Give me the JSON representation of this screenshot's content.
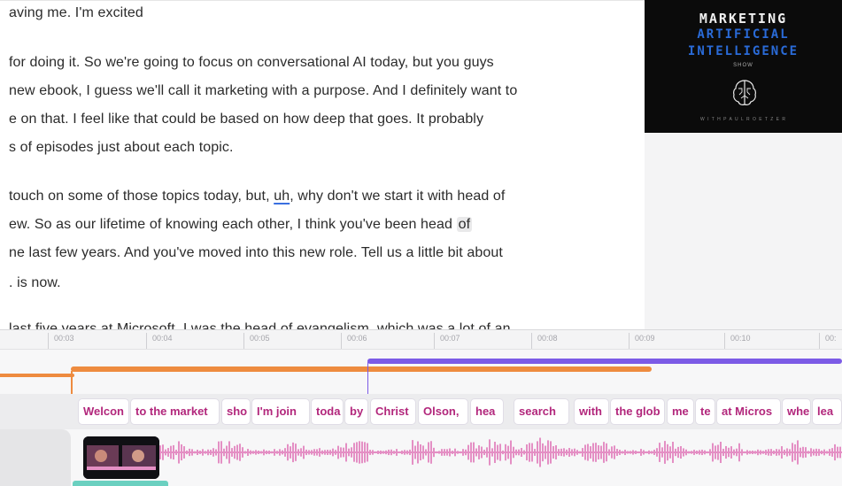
{
  "transcript": {
    "lines": [
      "aving me. I'm excited",
      " for doing it. So we're going to focus on conversational AI today, but you guys",
      "new ebook, I guess we'll call it marketing with a purpose. And I definitely want to",
      "e on that. I feel like that could be based on how deep that goes. It probably",
      "s of episodes just about each topic.",
      "touch on some of those topics today, but, ",
      "ew. So as our lifetime of knowing each other, I think you've been head ",
      "ne last few years. And you've moved into this new role. Tell us a little bit about",
      ". is now.",
      "last five years at Microsoft, I was the head of evangelism, which was a lot of an"
    ],
    "line6_underlined": "uh",
    "line6_rest": ", why don't we start it with head of",
    "line7_highlighted": "of"
  },
  "podcast_art": {
    "line1": "MARKETING",
    "line2": "ARTIFICIAL",
    "line3": "INTELLIGENCE",
    "line4": "SHOW",
    "footer": "W I T H  P A U L  R O E T Z E R"
  },
  "ruler": {
    "ticks": [
      "00:03",
      "00:04",
      "00:05",
      "00:06",
      "00:07",
      "00:08",
      "00:09",
      "00:10",
      "00:"
    ]
  },
  "words": [
    "Welcon",
    "to the market",
    "sho",
    "I'm join",
    "toda",
    "by",
    "Christ",
    "Olson,",
    "hea",
    "search",
    "with",
    "the glob",
    "me",
    "te",
    "at Micros",
    "whe",
    "lea"
  ],
  "colors": {
    "accent_purple": "#7c5be6",
    "accent_orange": "#ee8b3f",
    "word_pink": "#b2277c",
    "wave_pink": "#e48fc4",
    "clip_teal": "#6bd0c0"
  }
}
